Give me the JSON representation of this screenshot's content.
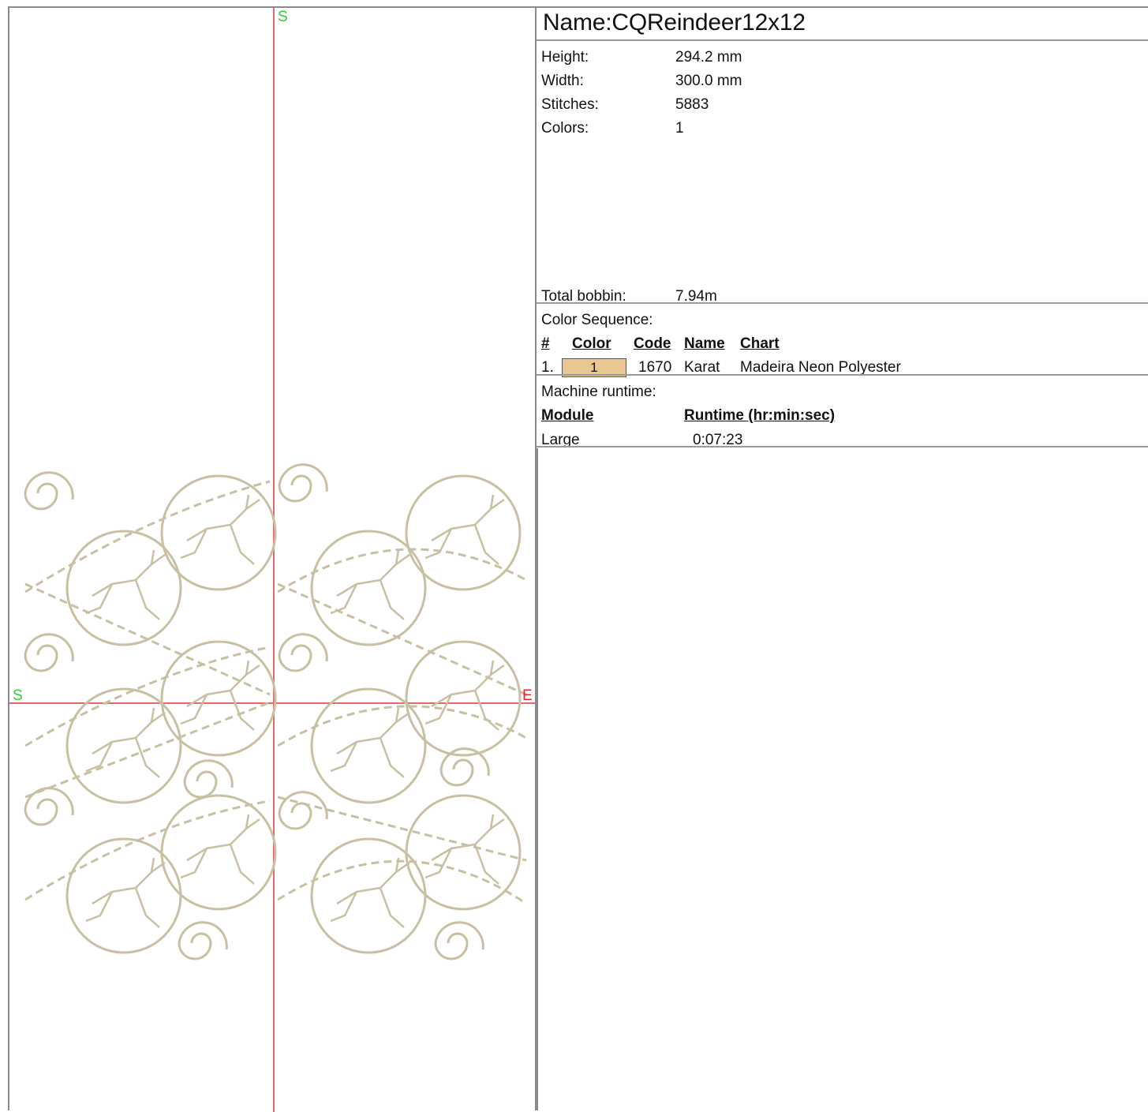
{
  "preview": {
    "start_label_top": "S",
    "start_label_left": "S",
    "end_label": "E",
    "thread_color": "#c9bfa3",
    "crosshair_color": "#e06a6a",
    "start_color": "#33cc33",
    "end_color": "#e02a2a"
  },
  "design": {
    "name": "Name:CQReindeer12x12"
  },
  "stats": [
    {
      "label": "Height:",
      "value": "294.2 mm"
    },
    {
      "label": "Width:",
      "value": "300.0 mm"
    },
    {
      "label": "Stitches:",
      "value": "5883"
    },
    {
      "label": "Colors:",
      "value": "1"
    }
  ],
  "bobbin": {
    "label": "Total bobbin:",
    "value": "7.94m"
  },
  "color_sequence": {
    "heading": "Color Sequence:",
    "headers": {
      "num": "#",
      "color": "Color",
      "code": "Code",
      "name": "Name",
      "chart": "Chart"
    },
    "rows": [
      {
        "num": "1.",
        "swatch_text": "1",
        "swatch_color": "#e8c890",
        "code": "1670",
        "name": "Karat",
        "chart": "Madeira Neon Polyester"
      }
    ]
  },
  "runtime": {
    "heading": "Machine runtime:",
    "headers": {
      "module": "Module",
      "runtime": "Runtime (hr:min:sec)"
    },
    "rows": [
      {
        "module": "Large",
        "runtime": "0:07:23"
      }
    ]
  }
}
